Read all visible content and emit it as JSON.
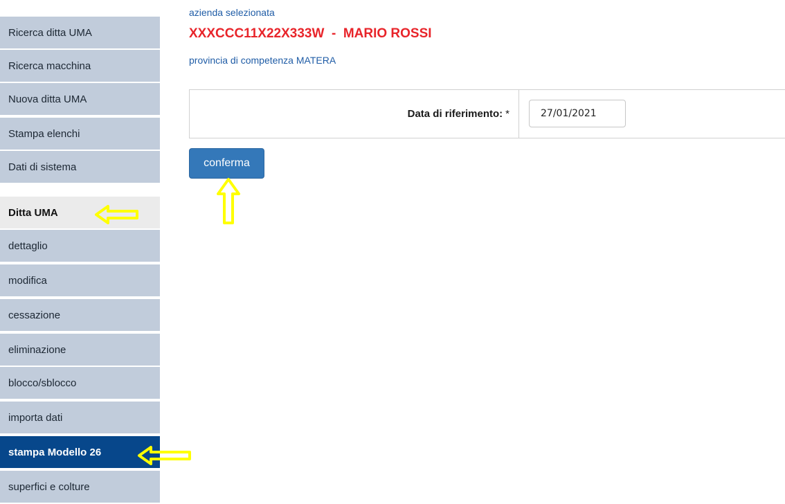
{
  "sidebar": {
    "items": [
      {
        "label": "Ricerca ditta UMA"
      },
      {
        "label": "Ricerca macchina"
      },
      {
        "label": "Nuova ditta UMA"
      },
      {
        "label": "Stampa elenchi"
      },
      {
        "label": "Dati di sistema"
      }
    ],
    "section_title": "Ditta UMA",
    "section_items": [
      {
        "label": "dettaglio"
      },
      {
        "label": "modifica"
      },
      {
        "label": "cessazione"
      },
      {
        "label": "eliminazione"
      },
      {
        "label": "blocco/sblocco"
      },
      {
        "label": "importa dati"
      },
      {
        "label": "stampa Modello 26"
      },
      {
        "label": "superfici e colture"
      }
    ],
    "active_item": "stampa Modello 26"
  },
  "header": {
    "selected_label": "azienda selezionata",
    "company": "XXXCCC11X22X333W  -  MARIO ROSSI",
    "province": "provincia di competenza MATERA"
  },
  "form": {
    "date_label": "Data di riferimento:",
    "required_mark": "*",
    "date_value": "27/01/2021"
  },
  "actions": {
    "confirm_label": "conferma"
  },
  "colors": {
    "sidebar_item": "#c1ccdb",
    "sidebar_active": "#07478b",
    "sidebar_section": "#ebebeb",
    "company_text": "#e8242a",
    "link_text": "#1f5ca6",
    "button": "#3478b9",
    "annotation_arrow": "#ffff00"
  }
}
